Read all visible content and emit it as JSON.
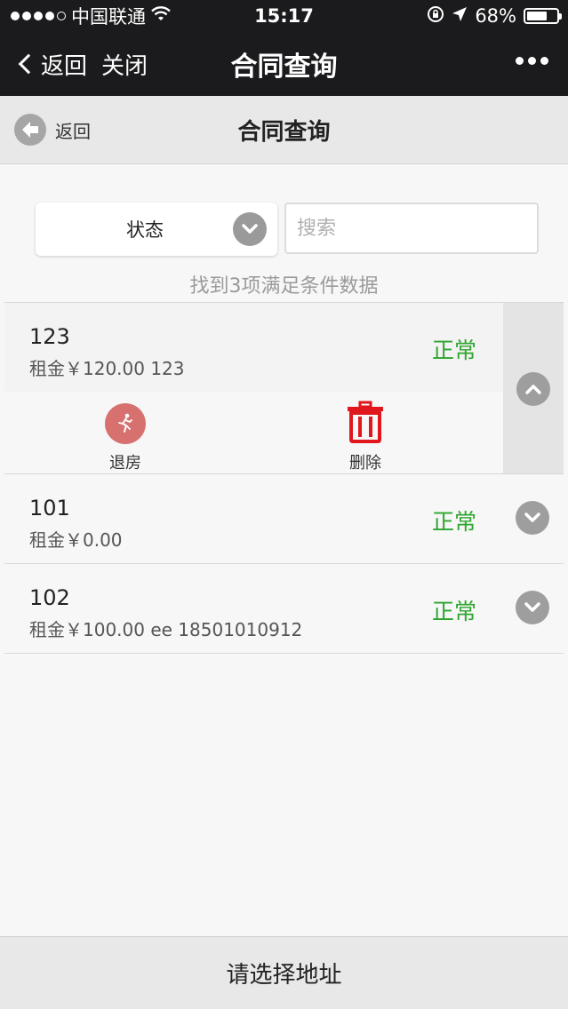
{
  "status_bar": {
    "carrier": "中国联通",
    "time": "15:17",
    "battery": "68%",
    "battery_level": 0.68
  },
  "wechat_nav": {
    "back_label": "返回",
    "close_label": "关闭",
    "title": "合同查询"
  },
  "page_header": {
    "back_label": "返回",
    "title": "合同查询"
  },
  "filter": {
    "status_label": "状态",
    "search_placeholder": "搜索",
    "result_text": "找到3项满足条件数据"
  },
  "contracts": [
    {
      "title": "123",
      "subtitle": "租金￥120.00 123",
      "state": "正常",
      "expanded": true,
      "actions": [
        {
          "label": "退房",
          "icon": "running-man-icon"
        },
        {
          "label": "删除",
          "icon": "trash-icon"
        }
      ]
    },
    {
      "title": "101",
      "subtitle": "租金￥0.00",
      "state": "正常",
      "expanded": false
    },
    {
      "title": "102",
      "subtitle": "租金￥100.00 ee 18501010912",
      "state": "正常",
      "expanded": false
    }
  ],
  "bottom_bar": {
    "label": "请选择地址"
  },
  "colors": {
    "status_ok": "#2ea52e",
    "delete_red": "#e0171c",
    "checkout_circle": "#d7716f",
    "nav_bg": "#1b1b1d"
  }
}
